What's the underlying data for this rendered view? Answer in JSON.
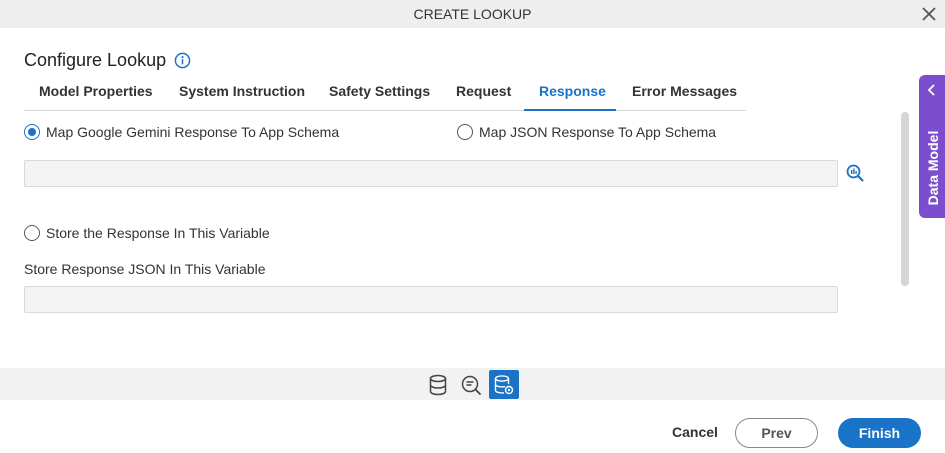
{
  "dialog": {
    "title": "CREATE LOOKUP",
    "close_icon": "close-icon"
  },
  "heading": {
    "text": "Configure Lookup",
    "info_icon": "info-icon"
  },
  "tabs": [
    {
      "label": "Model Properties",
      "active": false
    },
    {
      "label": "System Instruction",
      "active": false
    },
    {
      "label": "Safety Settings",
      "active": false
    },
    {
      "label": "Request",
      "active": false
    },
    {
      "label": "Response",
      "active": true
    },
    {
      "label": "Error Messages",
      "active": false
    }
  ],
  "response": {
    "radio_map_gemini": {
      "label": "Map Google Gemini Response To App Schema",
      "checked": true
    },
    "radio_map_json": {
      "label": "Map JSON Response To App Schema",
      "checked": false
    },
    "schema_field": {
      "value": ""
    },
    "schema_search_icon": "search-magnify-icon",
    "radio_store_variable": {
      "label": "Store the Response In This Variable",
      "checked": false
    },
    "store_json_label": "Store Response JSON In This Variable",
    "store_json_field": {
      "value": ""
    }
  },
  "side_panel": {
    "label": "Data Model",
    "icon": "chevron-left-icon"
  },
  "icon_bar": [
    {
      "icon": "database-icon",
      "active": false
    },
    {
      "icon": "search-list-icon",
      "active": false
    },
    {
      "icon": "database-settings-icon",
      "active": true
    }
  ],
  "footer": {
    "cancel_label": "Cancel",
    "prev_label": "Prev",
    "finish_label": "Finish"
  },
  "colors": {
    "accent": "#1a73c7",
    "side_tab": "#7c4dcf",
    "title_bar": "#eeeeee",
    "field_bg": "#f4f4f4"
  }
}
